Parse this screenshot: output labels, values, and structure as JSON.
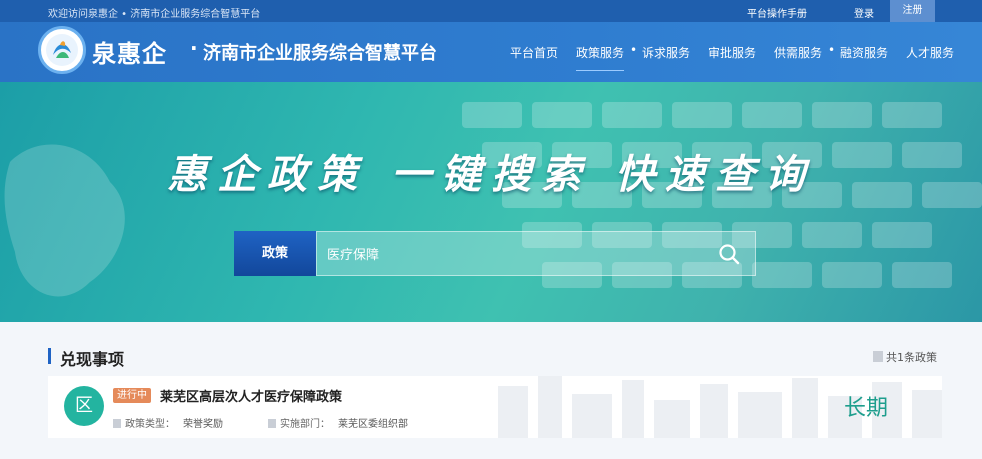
{
  "topbar": {
    "welcome": "欢迎访问泉惠企 • 济南市企业服务综合智慧平台",
    "manual": "平台操作手册",
    "login": "登录",
    "register": "注册"
  },
  "header": {
    "brand": "泉惠企",
    "dot": "·",
    "platform_name": "济南市企业服务综合智慧平台",
    "nav": [
      "平台首页",
      "政策服务",
      "诉求服务",
      "审批服务",
      "供需服务",
      "融资服务",
      "人才服务"
    ],
    "nav_separator": "•"
  },
  "hero": {
    "slogan": "惠企政策 一键搜索 快速查询",
    "search": {
      "category": "政策",
      "value": "医疗保障"
    }
  },
  "section": {
    "title": "兑现事项",
    "count": "共1条政策"
  },
  "policy": {
    "avatar": "区",
    "status": "进行中",
    "title": "莱芜区高层次人才医疗保障政策",
    "type_label": "政策类型：",
    "type_value": "荣誉奖励",
    "dept_label": "实施部门：",
    "dept_value": "莱芜区委组织部",
    "term": "长期"
  },
  "colors": {
    "topbar": "#1f5fae",
    "header": "#2f7dd0",
    "hero": "#2fb7b0",
    "status": "#e58a5a",
    "avatar": "#23b4a0"
  }
}
